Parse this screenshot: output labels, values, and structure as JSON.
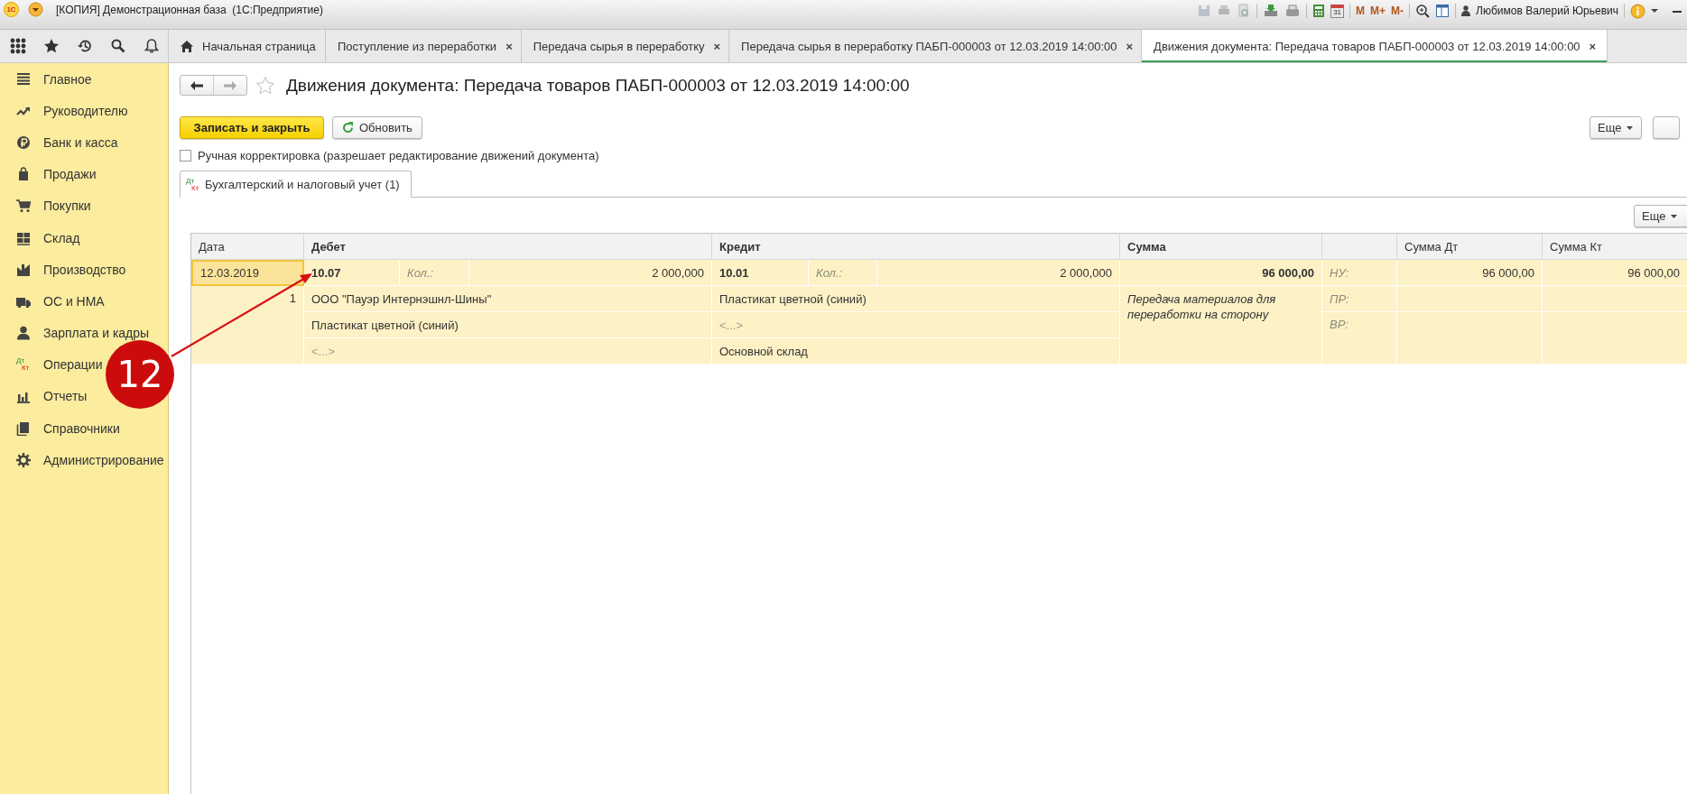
{
  "window": {
    "title": "[КОПИЯ] Демонстрационная база  (1С:Предприятие)",
    "logo": "1С"
  },
  "toolbar": {
    "calendar_day": "31",
    "memory_buttons": [
      "M",
      "M+",
      "M-"
    ],
    "user": "Любимов Валерий Юрьевич"
  },
  "tabs": [
    {
      "label": "Начальная страница",
      "kind": "home",
      "selected": false
    },
    {
      "label": "Поступление из переработки",
      "kind": "doc",
      "close": "×",
      "selected": false
    },
    {
      "label": "Передача сырья в переработку",
      "kind": "doc",
      "close": "×",
      "selected": false
    },
    {
      "label": "Передача сырья в переработку ПАБП-000003 от 12.03.2019 14:00:00",
      "kind": "doc",
      "close": "×",
      "selected": false
    },
    {
      "label": "Движения документа: Передача товаров ПАБП-000003 от 12.03.2019 14:00:00",
      "kind": "doc",
      "close": "×",
      "selected": true
    }
  ],
  "sidebar": {
    "items": [
      {
        "label": "Главное"
      },
      {
        "label": "Руководителю"
      },
      {
        "label": "Банк и касса"
      },
      {
        "label": "Продажи"
      },
      {
        "label": "Покупки"
      },
      {
        "label": "Склад"
      },
      {
        "label": "Производство"
      },
      {
        "label": "ОС и НМА"
      },
      {
        "label": "Зарплата и кадры"
      },
      {
        "label": "Операции",
        "icon_text": [
          "Дт",
          "Кт"
        ]
      },
      {
        "label": "Отчеты"
      },
      {
        "label": "Справочники"
      },
      {
        "label": "Администрирование"
      }
    ]
  },
  "document": {
    "title": "Движения документа: Передача товаров ПАБП-000003 от 12.03.2019 14:00:00",
    "buttons": [
      {
        "label": "Записать и закрыть",
        "kind": "primary"
      },
      {
        "label": "Обновить",
        "kind": "refresh"
      }
    ],
    "more_button": "Еще",
    "manual_correction": {
      "label": "Ручная корректировка (разрешает редактирование движений документа)",
      "checked": false
    },
    "register_tabs": [
      {
        "label": "Бухгалтерский и налоговый учет (1)",
        "icon_text": [
          "Дт",
          "Кт"
        ],
        "selected": true
      }
    ],
    "table_more_button": "Еще"
  },
  "table": {
    "columns": {
      "date": "Дата",
      "debit": "Дебет",
      "credit": "Кредит",
      "sum": "Сумма",
      "sum_dt": "Сумма Дт",
      "sum_kt": "Сумма Кт"
    },
    "rows": [
      {
        "date": "12.03.2019",
        "selected": true,
        "number": "1",
        "debit": {
          "account": "10.07",
          "qty_label": "Кол.:",
          "qty": "2 000,000",
          "subconto": [
            {
              "text": "ООО \"Пауэр Интернэшнл-Шины\"",
              "empty": false
            },
            {
              "text": "Пластикат цветной (синий)",
              "empty": false
            },
            {
              "text": "<...>",
              "empty": true
            }
          ]
        },
        "credit": {
          "account": "10.01",
          "qty_label": "Кол.:",
          "qty": "2 000,000",
          "subconto": [
            {
              "text": "Пластикат цветной (синий)",
              "empty": false
            },
            {
              "text": "<...>",
              "empty": true
            },
            {
              "text": "Основной склад",
              "empty": false
            }
          ]
        },
        "sum": "96 000,00",
        "content": "Передача материалов для переработки на сторону",
        "tax_labels": [
          "НУ:",
          "ПР:",
          "ВР:"
        ],
        "sum_dt": "96 000,00",
        "sum_kt": "96 000,00"
      }
    ]
  },
  "annotation": {
    "text": "12"
  }
}
